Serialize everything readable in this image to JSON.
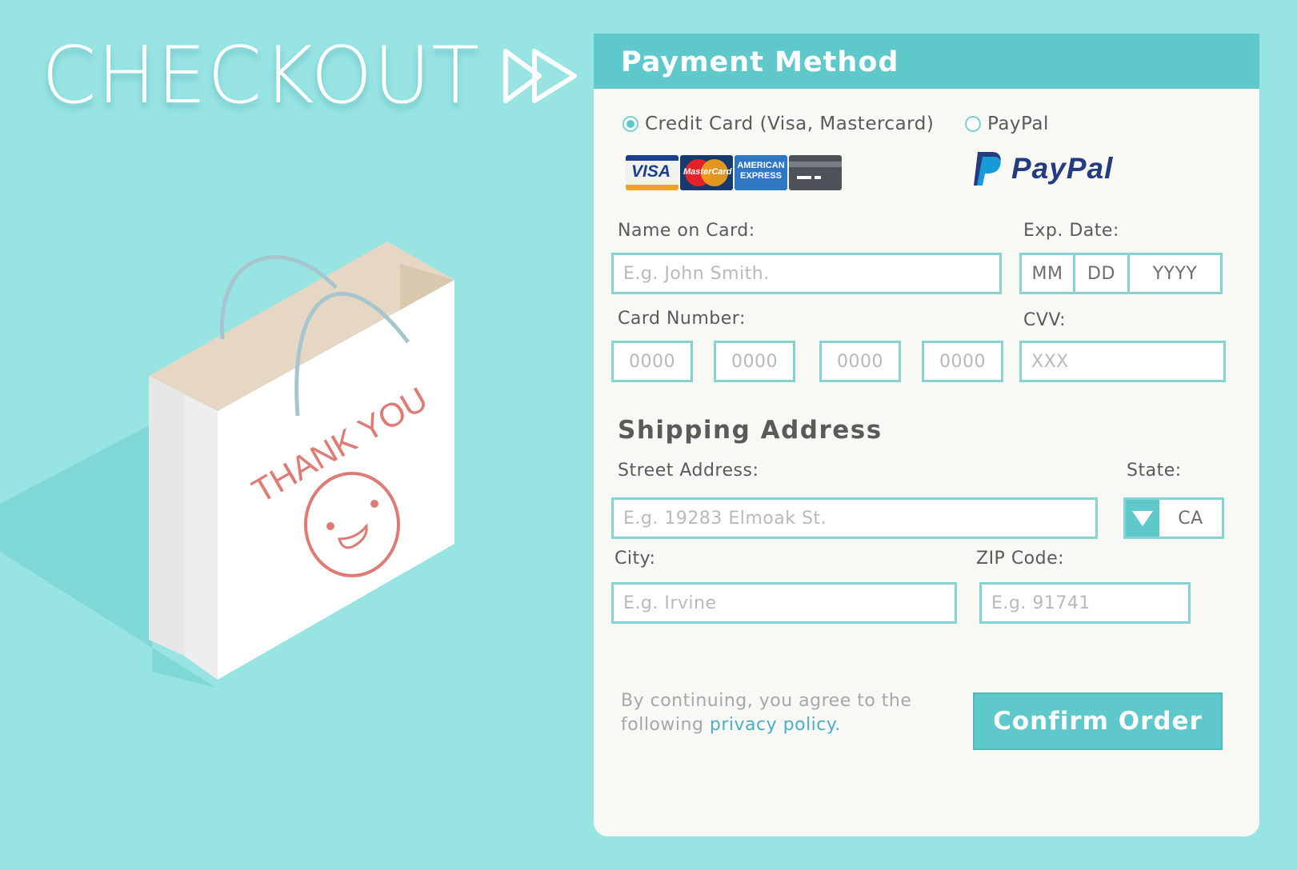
{
  "page": {
    "title": "CHECKOUT",
    "title_icon": "fast-forward-icon",
    "illustration": {
      "bag_text": "THANK YOU",
      "icon": "shopping-bag-icon"
    }
  },
  "panel": {
    "header": "Payment Method",
    "methods": [
      {
        "label": "Credit Card (Visa, Mastercard)",
        "selected": true,
        "logos": [
          "VISA",
          "MasterCard",
          "AMERICAN EXPRESS",
          "generic-card-icon"
        ]
      },
      {
        "label": "PayPal",
        "selected": false,
        "logo": "PayPal"
      }
    ],
    "name_on_card": {
      "label": "Name on Card:",
      "placeholder": "E.g. John Smith."
    },
    "exp_date": {
      "label": "Exp. Date:",
      "parts": [
        "MM",
        "DD",
        "YYYY"
      ]
    },
    "card_number": {
      "label": "Card Number:",
      "groups": [
        "0000",
        "0000",
        "0000",
        "0000"
      ]
    },
    "cvv": {
      "label": "CVV:",
      "placeholder": "XXX"
    },
    "shipping": {
      "title": "Shipping Address",
      "street": {
        "label": "Street Address:",
        "placeholder": "E.g. 19283 Elmoak St."
      },
      "state": {
        "label": "State:",
        "value": "CA",
        "icon": "caret-down-icon"
      },
      "city": {
        "label": "City:",
        "placeholder": "E.g. Irvine"
      },
      "zip": {
        "label": "ZIP Code:",
        "placeholder": "E.g. 91741"
      }
    },
    "policy": {
      "text_line1": "By continuing, you agree to the",
      "text_line2": "following",
      "link": "privacy policy."
    },
    "confirm_label": "Confirm Order"
  },
  "colors": {
    "background": "#97e4e3",
    "accent": "#5ec8ca",
    "field_border": "#86d3d2",
    "panel_bg": "#f8f8f4",
    "link": "#4eaec5",
    "bag_text": "#e07a74"
  }
}
